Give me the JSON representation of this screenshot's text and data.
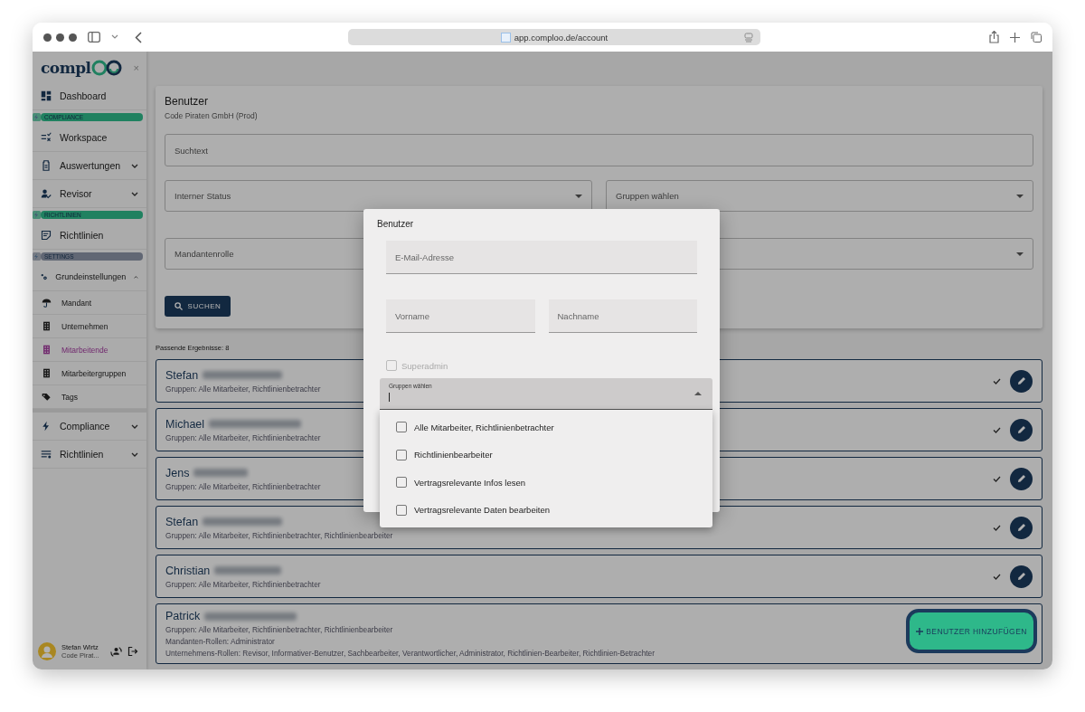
{
  "browser": {
    "url": "app.comploo.de/account"
  },
  "sidebar": {
    "logo": "compl",
    "close": "×",
    "entries": [
      {
        "kind": "item",
        "label": "Dashboard",
        "selected": false
      },
      {
        "kind": "section",
        "label": "COMPLIANCE",
        "color": "#208160"
      },
      {
        "kind": "item",
        "label": "Workspace",
        "selected": false
      },
      {
        "kind": "group",
        "label": "Auswertungen",
        "expanded": false
      },
      {
        "kind": "group",
        "label": "Revisor",
        "expanded": false
      },
      {
        "kind": "section",
        "label": "RICHTLINIEN",
        "color": "#208160"
      },
      {
        "kind": "item",
        "label": "Richtlinien",
        "selected": false
      },
      {
        "kind": "section",
        "label": "SETTINGS",
        "color": "#616774"
      },
      {
        "kind": "group",
        "label": "Grundeinstellungen",
        "expanded": true,
        "children": [
          {
            "label": "Mandant",
            "selected": false
          },
          {
            "label": "Unternehmen",
            "selected": false
          },
          {
            "label": "Mitarbeitende",
            "selected": true
          },
          {
            "label": "Mitarbeitergruppen",
            "selected": false
          },
          {
            "label": "Tags",
            "selected": false
          }
        ]
      },
      {
        "kind": "group",
        "label": "Compliance",
        "expanded": false
      },
      {
        "kind": "group",
        "label": "Richtlinien",
        "expanded": false
      }
    ],
    "user": {
      "name": "Stefan Wirtz",
      "org": "Code Pirat..."
    }
  },
  "filter": {
    "title": "Benutzer",
    "subtitle": "Code Piraten GmbH (Prod)",
    "search": {
      "placeholder": "Suchtext"
    },
    "selects": [
      {
        "label": "Interner Status"
      },
      {
        "label": "Gruppen wählen"
      },
      {
        "label": "Mandantenrolle"
      }
    ],
    "button": "SUCHEN"
  },
  "results": {
    "count": "Passende Ergebnisse: 8",
    "users": [
      {
        "first_name": "Stefan",
        "lines": [
          "Gruppen: Alle Mitarbeiter, Richtlinienbetrachter"
        ]
      },
      {
        "first_name": "Michael",
        "lines": [
          "Gruppen: Alle Mitarbeiter, Richtlinienbetrachter"
        ]
      },
      {
        "first_name": "Jens",
        "lines": [
          "Gruppen: Alle Mitarbeiter, Richtlinienbetrachter"
        ]
      },
      {
        "first_name": "Stefan",
        "lines": [
          "Gruppen: Alle Mitarbeiter, Richtlinienbetrachter, Richtlinienbearbeiter"
        ]
      },
      {
        "first_name": "Christian",
        "lines": [
          "Gruppen: Alle Mitarbeiter, Richtlinienbetrachter"
        ]
      },
      {
        "first_name": "Patrick",
        "lines": [
          "Gruppen: Alle Mitarbeiter, Richtlinienbetrachter, Richtlinienbearbeiter",
          "Mandanten-Rollen: Administrator",
          "Unternehmens-Rollen: Revisor, Informativer-Benutzer, Sachbearbeiter, Verantwortlicher, Administrator, Richtlinien-Bearbeiter, Richtlinien-Betrachter"
        ]
      }
    ]
  },
  "add_button": "BENUTZER HINZUFÜGEN",
  "dialog": {
    "title": "Benutzer",
    "email": {
      "placeholder": "E-Mail-Adresse"
    },
    "first_name": {
      "placeholder": "Vorname"
    },
    "last_name": {
      "placeholder": "Nachname"
    },
    "superadmin": {
      "label": "Superadmin",
      "checked": false,
      "disabled": true
    },
    "groups": {
      "label": "Gruppen wählen",
      "expanded": true,
      "options": [
        {
          "label": "Alle Mitarbeiter, Richtlinienbetrachter",
          "checked": false
        },
        {
          "label": "Richtlinienbearbeiter",
          "checked": false
        },
        {
          "label": "Vertragsrelevante Infos lesen",
          "checked": false
        },
        {
          "label": "Vertragsrelevante Daten bearbeiten",
          "checked": false
        }
      ]
    }
  }
}
